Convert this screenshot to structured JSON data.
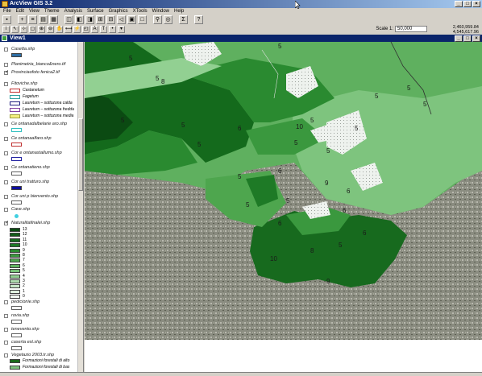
{
  "app": {
    "title": "ArcView GIS 3.2"
  },
  "menu": [
    "File",
    "Edit",
    "View",
    "Theme",
    "Analysis",
    "Surface",
    "Graphics",
    "XTools",
    "Window",
    "Help"
  ],
  "toolbar": {
    "scale_label": "Scale 1:",
    "scale_value": "50,000",
    "coord_x": "2,460,959.84",
    "coord_y": "4,545,617.96"
  },
  "view": {
    "title": "View1"
  },
  "legend": {
    "casetta": "Casetta.shp",
    "planimetria": "Planimetria_bianco&nero.tif",
    "provincia": "Provinciaofoto fenica2.tif",
    "fitoviche": "Fitoviche.shp",
    "fitoviche_classes": [
      "Castanetum",
      "Fagetum",
      "Lauretum – sottozona calda",
      "Lauretum – sottozona fredda",
      "Lauretum – sottozona media"
    ],
    "ce_alberi": "Ce ontanadalbelarie aro.shp",
    "ce_alfaro": "Ce ontanaalfaro.shp",
    "ce_stallumo": "Cor e ontanastallumo.shp",
    "ce_tieno": "Ce ontanatieno.shp",
    "cor_tratturo": "Cor uni tratturo.shp",
    "cor_bienvento": "Cor uni p bienvento.shp",
    "cave": "Cave.shp",
    "naturalita": "Naturalitafinalei.shp",
    "naturalita_classes": [
      "13",
      "12",
      "11",
      "10",
      "9",
      "8",
      "7",
      "6",
      "5",
      "4",
      "3",
      "2",
      "1",
      "0"
    ],
    "pediaiche": "pedicionie.shp",
    "rovia": "rovia.shp",
    "tenevento": "tenevento.shp",
    "caserta": "caserta est.shp",
    "vegetazio": "Vegetazio 2003.tr.shp",
    "veg_classes": [
      "Formazioni forestali di alto",
      "Formazioni forestali di bas"
    ]
  },
  "map_labels": [
    "5",
    "5",
    "5",
    "8",
    "5",
    "5",
    "5",
    "6",
    "5",
    "5",
    "5",
    "5",
    "5",
    "10",
    "6",
    "9",
    "5",
    "5",
    "6",
    "5",
    "6",
    "8",
    "5",
    "10",
    "9",
    "6",
    "6",
    "5",
    "5"
  ],
  "colors": {
    "title_bar": "#0a246a",
    "nat13": "#0b4a12",
    "nat12": "#125a18",
    "nat11": "#176a1e",
    "nat10": "#1e7a26",
    "nat9": "#2a8a30",
    "nat8": "#3a983e",
    "nat7": "#4ea64e",
    "nat6": "#62b462",
    "nat5": "#79c279",
    "nat4": "#92d092",
    "nat3": "#aedcae",
    "nat2": "#c8e8c8",
    "nat1": "#e0f2e0",
    "nat0": "#f4fbf4"
  }
}
